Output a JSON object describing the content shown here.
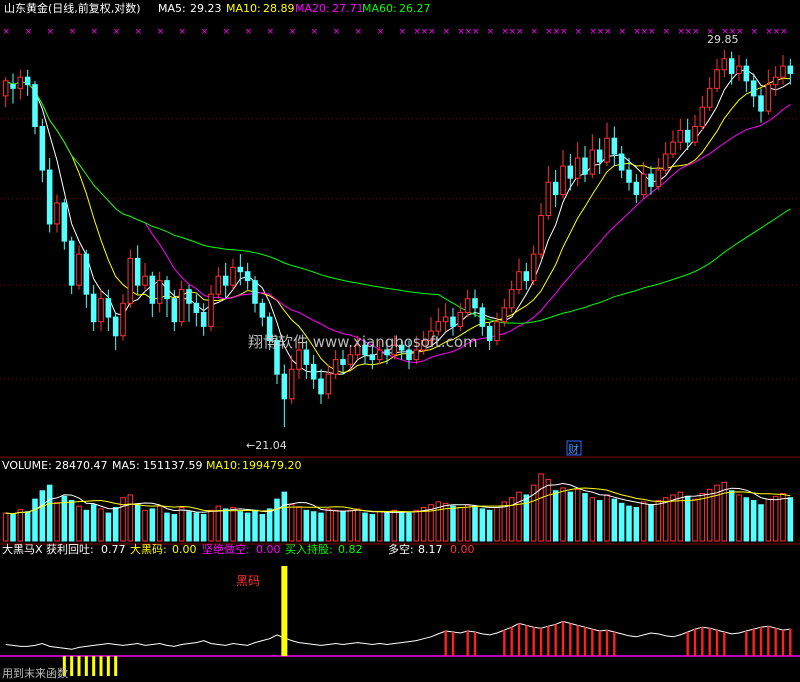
{
  "header": {
    "title": "山东黄金(日线,前复权,对数)",
    "ma5": {
      "label": "MA5:",
      "value": "29.23"
    },
    "ma10": {
      "label": "MA10:",
      "value": "28.89"
    },
    "ma20": {
      "label": "MA20:",
      "value": "27.71"
    },
    "ma60": {
      "label": "MA60:",
      "value": "26.27"
    }
  },
  "price_panel": {
    "high_label": "29.85",
    "low_label": "←21.04",
    "cai_badge": "财",
    "watermark": "翔博软件 www.xiangbosoft.com"
  },
  "volume_panel": {
    "volume": {
      "label": "VOLUME:",
      "value": "28470.47"
    },
    "ma5": {
      "label": "MA5:",
      "value": "151137.59"
    },
    "ma10": {
      "label": "MA10:",
      "value": "199479.20"
    }
  },
  "indicator_panel": {
    "name": "大黑马X",
    "profit_back": {
      "label": "获利回吐:",
      "value": "0.77"
    },
    "big_black_horse": {
      "label": "大黑码:",
      "value": "0.00"
    },
    "firm_short": {
      "label": "坚绝做空:",
      "value": "0.00"
    },
    "buy_hold": {
      "label": "买入持股:",
      "value": "0.82"
    },
    "long_short": {
      "label": "多空:",
      "value": "8.17"
    },
    "long_short_extra": "0.00",
    "annotation": "黑码",
    "footer_text": "用到末来函数"
  },
  "colors": {
    "up": "#ff3232",
    "down": "#54ffff",
    "ma5": "#ffffff",
    "ma10": "#ffff00",
    "ma20": "#ff00ff",
    "ma60": "#00ff00",
    "grid": "#800000",
    "marker": "#ff00ff"
  },
  "chart_data": {
    "type": "candlestick",
    "y_scale": "log",
    "price_range": [
      20.6,
      30.4
    ],
    "highest": 29.85,
    "lowest": 21.04,
    "candles": [
      [
        28.6,
        29.0,
        28.3,
        29.1
      ],
      [
        28.9,
        28.8,
        28.4,
        29.2
      ],
      [
        28.8,
        29.1,
        28.5,
        29.3
      ],
      [
        29.1,
        28.9,
        28.6,
        29.3
      ],
      [
        28.9,
        27.8,
        27.6,
        29.0
      ],
      [
        27.8,
        26.7,
        26.4,
        28.0
      ],
      [
        26.7,
        25.4,
        25.2,
        27.0
      ],
      [
        25.4,
        25.9,
        25.2,
        26.1
      ],
      [
        25.9,
        25.0,
        24.8,
        26.0
      ],
      [
        25.0,
        24.0,
        23.8,
        25.1
      ],
      [
        24.0,
        24.7,
        23.9,
        24.9
      ],
      [
        24.7,
        23.8,
        23.5,
        24.8
      ],
      [
        23.8,
        23.2,
        23.0,
        24.0
      ],
      [
        23.2,
        23.7,
        23.0,
        23.9
      ],
      [
        23.7,
        23.3,
        23.0,
        23.9
      ],
      [
        23.3,
        22.9,
        22.6,
        23.4
      ],
      [
        22.9,
        23.6,
        22.8,
        23.8
      ],
      [
        23.6,
        24.6,
        23.5,
        24.8
      ],
      [
        24.6,
        24.0,
        23.8,
        24.9
      ],
      [
        24.0,
        24.2,
        23.9,
        24.5
      ],
      [
        24.2,
        23.6,
        23.3,
        24.3
      ],
      [
        23.6,
        24.1,
        23.4,
        24.3
      ],
      [
        24.1,
        23.7,
        23.3,
        24.2
      ],
      [
        23.7,
        23.2,
        23.0,
        23.9
      ],
      [
        23.2,
        23.9,
        23.1,
        24.1
      ],
      [
        23.9,
        23.6,
        23.2,
        24.0
      ],
      [
        23.6,
        23.4,
        23.1,
        23.8
      ],
      [
        23.4,
        23.1,
        22.9,
        23.6
      ],
      [
        23.1,
        23.8,
        23.0,
        24.0
      ],
      [
        23.8,
        24.2,
        23.7,
        24.4
      ],
      [
        24.2,
        24.0,
        23.7,
        24.5
      ],
      [
        24.0,
        24.4,
        23.9,
        24.6
      ],
      [
        24.4,
        24.3,
        24.0,
        24.7
      ],
      [
        24.3,
        24.1,
        23.9,
        24.5
      ],
      [
        24.1,
        23.6,
        23.4,
        24.2
      ],
      [
        23.6,
        23.3,
        23.1,
        23.7
      ],
      [
        23.3,
        22.8,
        22.6,
        23.4
      ],
      [
        22.8,
        22.1,
        21.9,
        22.9
      ],
      [
        22.1,
        21.6,
        21.04,
        22.3
      ],
      [
        21.6,
        22.2,
        21.5,
        22.5
      ],
      [
        22.2,
        22.6,
        22.0,
        22.8
      ],
      [
        22.6,
        22.3,
        22.0,
        22.8
      ],
      [
        22.3,
        22.0,
        21.8,
        22.5
      ],
      [
        22.0,
        21.7,
        21.5,
        22.2
      ],
      [
        21.7,
        22.1,
        21.6,
        22.3
      ],
      [
        22.1,
        22.4,
        22.0,
        22.6
      ],
      [
        22.4,
        22.3,
        22.1,
        22.6
      ],
      [
        22.3,
        22.5,
        22.2,
        22.7
      ],
      [
        22.5,
        22.7,
        22.4,
        22.9
      ],
      [
        22.7,
        22.5,
        22.3,
        22.8
      ],
      [
        22.5,
        22.4,
        22.2,
        22.7
      ],
      [
        22.4,
        22.6,
        22.3,
        22.8
      ],
      [
        22.6,
        22.5,
        22.3,
        22.8
      ],
      [
        22.5,
        22.7,
        22.4,
        22.9
      ],
      [
        22.7,
        22.6,
        22.4,
        22.8
      ],
      [
        22.6,
        22.4,
        22.2,
        22.8
      ],
      [
        22.4,
        22.6,
        22.3,
        22.9
      ],
      [
        22.6,
        22.8,
        22.5,
        23.0
      ],
      [
        22.8,
        23.0,
        22.7,
        23.3
      ],
      [
        23.0,
        23.2,
        22.9,
        23.5
      ],
      [
        23.2,
        23.3,
        23.0,
        23.6
      ],
      [
        23.3,
        23.1,
        22.9,
        23.5
      ],
      [
        23.1,
        23.4,
        23.0,
        23.6
      ],
      [
        23.4,
        23.7,
        23.3,
        23.9
      ],
      [
        23.7,
        23.5,
        23.3,
        23.9
      ],
      [
        23.5,
        23.1,
        22.9,
        23.6
      ],
      [
        23.1,
        22.8,
        22.6,
        23.2
      ],
      [
        22.8,
        23.2,
        22.7,
        23.4
      ],
      [
        23.2,
        23.5,
        23.1,
        23.7
      ],
      [
        23.5,
        23.9,
        23.4,
        24.1
      ],
      [
        23.9,
        24.3,
        23.8,
        24.6
      ],
      [
        24.3,
        24.1,
        23.9,
        24.5
      ],
      [
        24.1,
        24.7,
        24.0,
        24.9
      ],
      [
        24.7,
        25.6,
        24.6,
        25.9
      ],
      [
        25.6,
        26.4,
        25.5,
        26.8
      ],
      [
        26.4,
        26.1,
        25.8,
        26.7
      ],
      [
        26.1,
        26.8,
        26.0,
        27.2
      ],
      [
        26.8,
        26.5,
        26.2,
        27.1
      ],
      [
        26.5,
        27.0,
        26.3,
        27.4
      ],
      [
        27.0,
        26.6,
        26.4,
        27.3
      ],
      [
        26.6,
        27.2,
        26.5,
        27.6
      ],
      [
        27.2,
        26.9,
        26.6,
        27.5
      ],
      [
        26.9,
        27.5,
        26.8,
        27.9
      ],
      [
        27.5,
        27.1,
        26.8,
        27.8
      ],
      [
        27.1,
        26.7,
        26.5,
        27.3
      ],
      [
        26.7,
        26.4,
        26.2,
        27.0
      ],
      [
        26.4,
        26.1,
        25.9,
        26.6
      ],
      [
        26.1,
        26.6,
        26.0,
        26.9
      ],
      [
        26.6,
        26.3,
        26.1,
        26.8
      ],
      [
        26.3,
        26.7,
        26.2,
        27.0
      ],
      [
        26.7,
        27.1,
        26.6,
        27.4
      ],
      [
        27.1,
        27.4,
        27.0,
        27.7
      ],
      [
        27.4,
        27.7,
        27.2,
        28.0
      ],
      [
        27.7,
        27.4,
        27.2,
        28.0
      ],
      [
        27.4,
        27.8,
        27.3,
        28.1
      ],
      [
        27.8,
        28.3,
        27.7,
        28.6
      ],
      [
        28.3,
        28.8,
        28.2,
        29.1
      ],
      [
        28.8,
        29.3,
        28.7,
        29.6
      ],
      [
        29.3,
        29.6,
        29.1,
        29.85
      ],
      [
        29.6,
        29.2,
        28.9,
        29.8
      ],
      [
        29.2,
        29.4,
        29.0,
        29.7
      ],
      [
        29.4,
        29.0,
        28.7,
        29.6
      ],
      [
        29.0,
        28.6,
        28.3,
        29.2
      ],
      [
        28.6,
        28.2,
        27.9,
        28.8
      ],
      [
        28.2,
        28.9,
        28.1,
        29.3
      ],
      [
        28.9,
        29.1,
        28.6,
        29.4
      ],
      [
        29.1,
        29.4,
        28.9,
        29.7
      ],
      [
        29.4,
        29.2,
        28.9,
        29.6
      ]
    ],
    "volume": [
      40,
      38,
      45,
      42,
      60,
      72,
      80,
      55,
      64,
      58,
      50,
      44,
      52,
      46,
      40,
      48,
      62,
      66,
      52,
      44,
      46,
      50,
      40,
      38,
      48,
      42,
      40,
      38,
      44,
      50,
      46,
      48,
      42,
      40,
      44,
      38,
      46,
      60,
      70,
      52,
      48,
      44,
      42,
      40,
      46,
      44,
      42,
      44,
      46,
      40,
      38,
      42,
      40,
      44,
      42,
      40,
      44,
      48,
      52,
      56,
      54,
      50,
      48,
      52,
      50,
      46,
      44,
      48,
      56,
      62,
      70,
      66,
      80,
      96,
      88,
      72,
      76,
      70,
      74,
      68,
      62,
      58,
      66,
      60,
      54,
      50,
      48,
      56,
      52,
      58,
      62,
      66,
      70,
      64,
      60,
      68,
      74,
      80,
      84,
      72,
      66,
      62,
      58,
      52,
      60,
      64,
      68,
      62
    ],
    "indicator": {
      "line": [
        1.2,
        1.1,
        1.0,
        1.0,
        1.1,
        1.3,
        1.0,
        0.9,
        0.8,
        0.7,
        0.9,
        1.0,
        1.1,
        1.2,
        1.3,
        1.2,
        1.1,
        1.2,
        1.3,
        1.1,
        1.2,
        1.3,
        1.1,
        1.0,
        1.2,
        1.3,
        1.4,
        1.6,
        1.3,
        1.2,
        1.1,
        1.3,
        1.2,
        1.1,
        1.4,
        1.6,
        1.8,
        2.2,
        1.9,
        1.6,
        1.4,
        1.3,
        1.2,
        1.1,
        1.2,
        1.3,
        1.2,
        1.3,
        1.4,
        1.3,
        1.2,
        1.3,
        1.2,
        1.3,
        1.4,
        1.5,
        1.6,
        1.8,
        2.0,
        2.3,
        2.6,
        2.5,
        2.4,
        2.6,
        2.5,
        2.3,
        2.2,
        2.4,
        2.7,
        3.0,
        3.4,
        3.2,
        3.0,
        2.9,
        3.1,
        3.3,
        3.6,
        3.4,
        3.2,
        3.0,
        2.8,
        2.6,
        2.7,
        2.5,
        2.3,
        2.1,
        2.0,
        2.2,
        2.4,
        2.3,
        2.1,
        2.0,
        2.2,
        2.5,
        2.8,
        3.0,
        2.9,
        2.7,
        2.5,
        2.3,
        2.4,
        2.6,
        2.8,
        3.0,
        3.1,
        2.9,
        2.7,
        2.8
      ],
      "black_horse_signal_index": 38,
      "footer_signal_indices": [
        8,
        9,
        10,
        11,
        12,
        13,
        14,
        15
      ]
    }
  }
}
